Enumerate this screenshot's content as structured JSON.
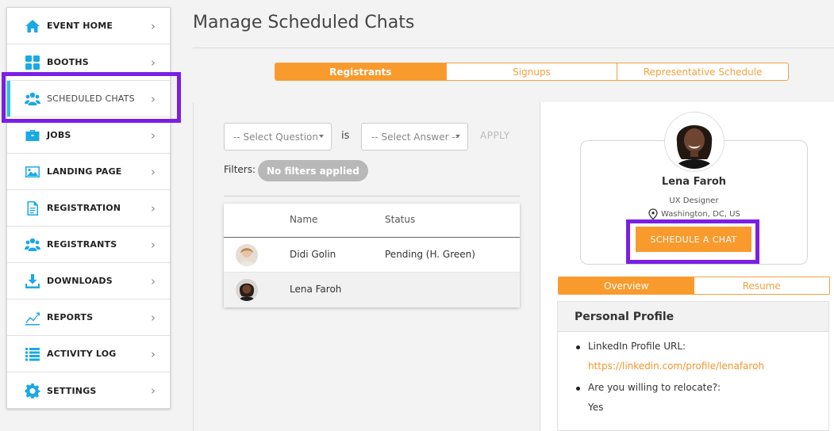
{
  "sidebar": {
    "items": [
      {
        "label": "EVENT HOME",
        "icon": "home-icon"
      },
      {
        "label": "BOOTHS",
        "icon": "booths-icon"
      },
      {
        "label": "SCHEDULED CHATS",
        "icon": "users-icon"
      },
      {
        "label": "JOBS",
        "icon": "briefcase-icon"
      },
      {
        "label": "LANDING PAGE",
        "icon": "image-icon"
      },
      {
        "label": "REGISTRATION",
        "icon": "document-icon"
      },
      {
        "label": "REGISTRANTS",
        "icon": "users-icon"
      },
      {
        "label": "DOWNLOADS",
        "icon": "download-icon"
      },
      {
        "label": "REPORTS",
        "icon": "chart-icon"
      },
      {
        "label": "ACTIVITY LOG",
        "icon": "list-icon"
      },
      {
        "label": "SETTINGS",
        "icon": "gear-icon"
      }
    ],
    "active_index": 2
  },
  "header": {
    "title": "Manage Scheduled Chats"
  },
  "tabs": [
    {
      "label": "Registrants",
      "active": true
    },
    {
      "label": "Signups",
      "active": false
    },
    {
      "label": "Representative Schedule",
      "active": false
    }
  ],
  "filters": {
    "question_placeholder": "-- Select Question",
    "is_label": "is",
    "answer_placeholder": "-- Select Answer --",
    "apply_label": "APPLY",
    "filters_label": "Filters:",
    "no_filters": "No filters applied"
  },
  "table": {
    "headers": {
      "name": "Name",
      "status": "Status"
    },
    "rows": [
      {
        "name": "Didi Golin",
        "status": "Pending (H. Green)"
      },
      {
        "name": "Lena Faroh",
        "status": ""
      }
    ]
  },
  "profile": {
    "name": "Lena Faroh",
    "role": "UX Designer",
    "location": "Washington, DC, US",
    "schedule_button": "SCHEDULE A CHAT",
    "subtabs": [
      "Overview",
      "Resume"
    ],
    "section_title": "Personal Profile",
    "fields": [
      {
        "label": "LinkedIn Profile URL:",
        "value": "https://linkedin.com/profile/lenafaroh"
      },
      {
        "label": "Are you willing to relocate?:",
        "value": "Yes"
      }
    ]
  },
  "colors": {
    "accent": "#f99a2d",
    "icon_blue": "#1aa9e4",
    "highlight": "#7a1fe5"
  }
}
